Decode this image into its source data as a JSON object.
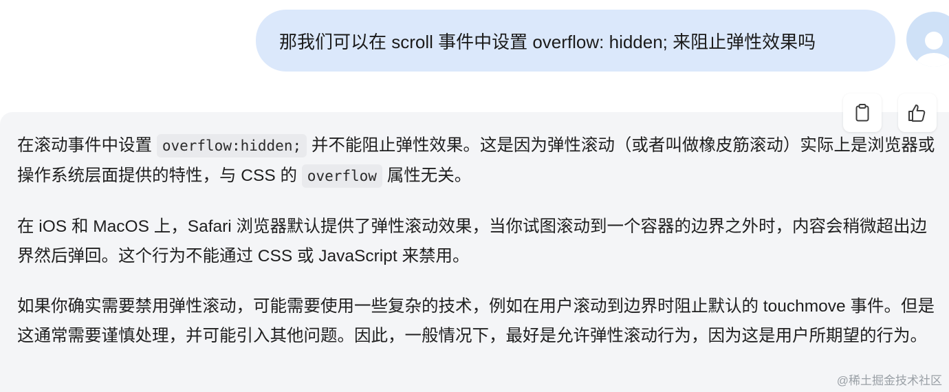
{
  "user_message": {
    "text": "那我们可以在 scroll 事件中设置 overflow: hidden; 来阻止弹性效果吗"
  },
  "assistant_message": {
    "p1": {
      "t1": "在滚动事件中设置 ",
      "code1": "overflow:hidden;",
      "t2": " 并不能阻止弹性效果。这是因为弹性滚动（或者叫做橡皮筋滚动）实际上是浏览器或操作系统层面提供的特性，与 CSS 的 ",
      "code2": "overflow",
      "t3": " 属性无关。"
    },
    "p2": "在 iOS 和 MacOS 上，Safari 浏览器默认提供了弹性滚动效果，当你试图滚动到一个容器的边界之外时，内容会稍微超出边界然后弹回。这个行为不能通过 CSS 或 JavaScript 来禁用。",
    "p3": "如果你确实需要禁用弹性滚动，可能需要使用一些复杂的技术，例如在用户滚动到边界时阻止默认的 touchmove 事件。但是这通常需要谨慎处理，并可能引入其他问题。因此，一般情况下，最好是允许弹性滚动行为，因为这是用户所期望的行为。"
  },
  "actions": {
    "copy_icon": "clipboard-icon",
    "like_icon": "thumbs-up-icon"
  },
  "watermark": "@稀土掘金技术社区",
  "colors": {
    "user_bubble": "#dbe8fb",
    "assistant_bg": "#f4f5f7",
    "code_bg": "#e9eaed",
    "avatar_bg": "#cfe1f7"
  }
}
